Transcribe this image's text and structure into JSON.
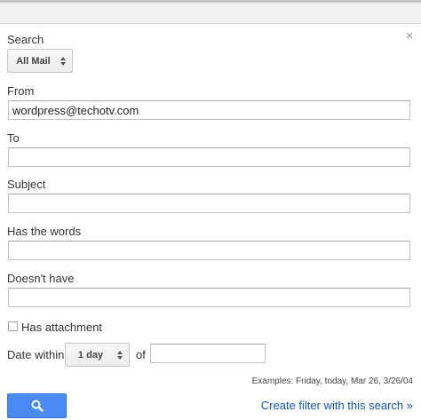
{
  "dialog": {
    "close_glyph": "×"
  },
  "search": {
    "label": "Search",
    "scope_selected": "All Mail"
  },
  "from": {
    "label": "From",
    "value": "wordpress@techotv.com"
  },
  "to": {
    "label": "To",
    "value": ""
  },
  "subject": {
    "label": "Subject",
    "value": ""
  },
  "has_words": {
    "label": "Has the words",
    "value": ""
  },
  "doesnt_have": {
    "label": "Doesn't have",
    "value": ""
  },
  "attachment": {
    "label": "Has attachment",
    "checked": false
  },
  "date": {
    "label": "Date within",
    "range_selected": "1 day",
    "of_label": "of",
    "value": "",
    "examples": "Examples: Friday, today, Mar 26, 3/26/04"
  },
  "actions": {
    "search_icon": "search-icon",
    "create_filter_label": "Create filter with this search »"
  },
  "colors": {
    "accent": "#4a8af4",
    "link": "#1155cc"
  }
}
